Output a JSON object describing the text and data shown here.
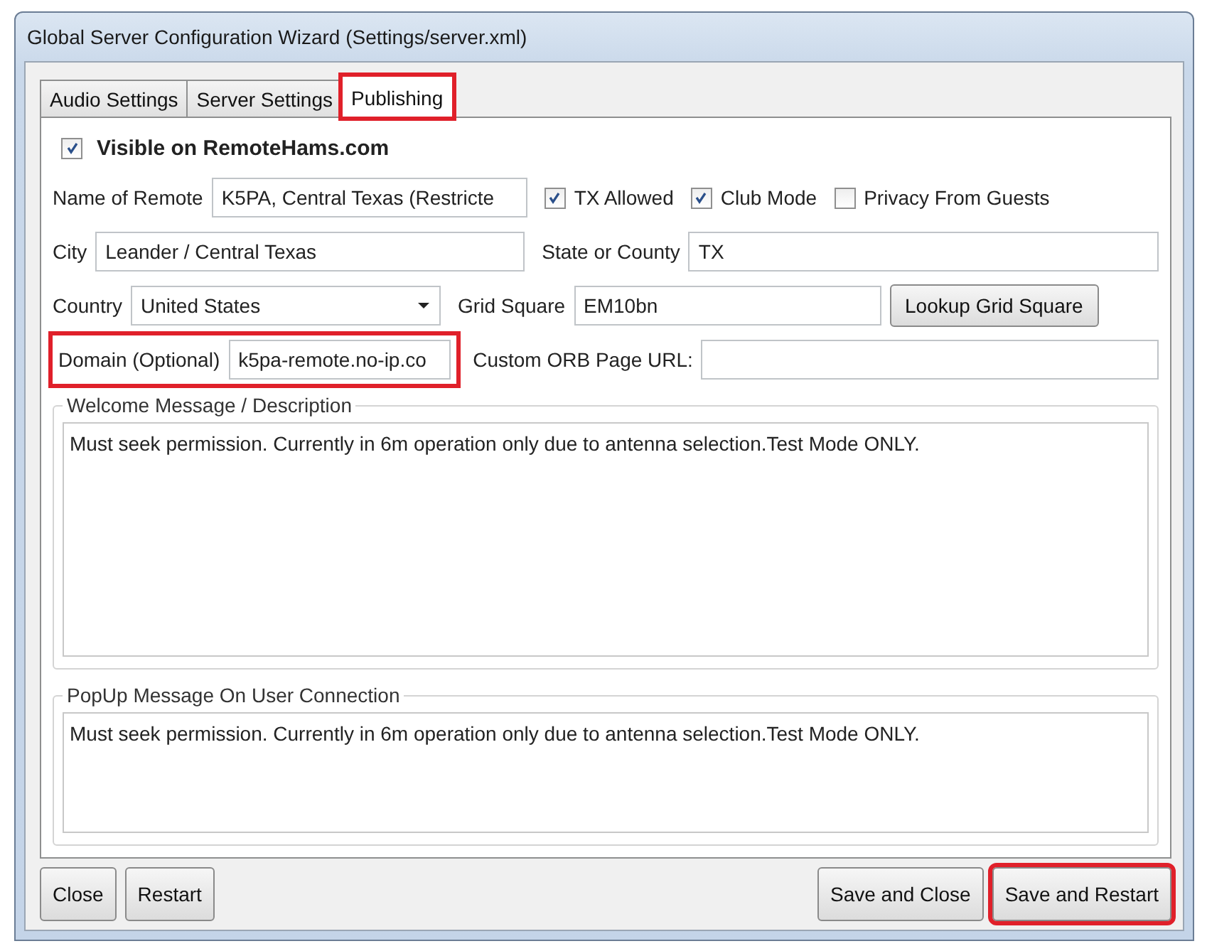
{
  "window": {
    "title": "Global Server Configuration Wizard (Settings/server.xml)"
  },
  "tabs": [
    {
      "label": "Audio Settings",
      "selected": false,
      "highlighted": false
    },
    {
      "label": "Server Settings",
      "selected": false,
      "highlighted": false
    },
    {
      "label": "Publishing",
      "selected": true,
      "highlighted": true
    }
  ],
  "visible": {
    "label": "Visible on RemoteHams.com",
    "checked": true
  },
  "name_of_remote": {
    "label": "Name of Remote",
    "value": "K5PA, Central Texas (Restricte"
  },
  "options": [
    {
      "label": "TX Allowed",
      "checked": true
    },
    {
      "label": "Club Mode",
      "checked": true
    },
    {
      "label": "Privacy From Guests",
      "checked": false
    }
  ],
  "city": {
    "label": "City",
    "value": "Leander / Central Texas"
  },
  "state": {
    "label": "State or County",
    "value": "TX"
  },
  "country": {
    "label": "Country",
    "value": "United States"
  },
  "grid_square": {
    "label": "Grid Square",
    "value": "EM10bn"
  },
  "lookup_button": "Lookup Grid Square",
  "domain": {
    "label": "Domain (Optional)",
    "value": "k5pa-remote.no-ip.co",
    "highlighted": true
  },
  "custom_orb": {
    "label": "Custom ORB Page URL:"
  },
  "welcome": {
    "legend": "Welcome Message / Description",
    "text": "Must seek permission. Currently in 6m operation only due to antenna selection.Test Mode ONLY."
  },
  "popup": {
    "legend": "PopUp Message On User Connection",
    "text": "Must seek permission. Currently in 6m operation only due to antenna selection.Test Mode ONLY."
  },
  "buttons_left": [
    {
      "label": "Close",
      "highlighted": false
    },
    {
      "label": "Restart",
      "highlighted": false
    }
  ],
  "buttons_right": [
    {
      "label": "Save and Close",
      "highlighted": false
    },
    {
      "label": "Save and Restart",
      "highlighted": true
    }
  ]
}
